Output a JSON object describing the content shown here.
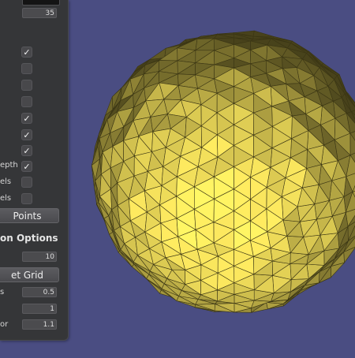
{
  "panel": {
    "number_top": "35",
    "checkboxes": [
      {
        "checked": true
      },
      {
        "checked": false
      },
      {
        "checked": false
      },
      {
        "checked": false
      },
      {
        "checked": true
      },
      {
        "checked": true
      },
      {
        "checked": true
      },
      {
        "checked": true,
        "label": "epth"
      },
      {
        "checked": false,
        "label": "els"
      },
      {
        "checked": false,
        "label": "els"
      }
    ],
    "points_button": "Points",
    "section_title": "on Options",
    "section_value": "10",
    "grid_button": "et Grid",
    "params": [
      {
        "label": "s",
        "value": "0.5"
      },
      {
        "label": "",
        "value": "1"
      },
      {
        "label": "or",
        "value": "1.1"
      }
    ],
    "check_glyph": "✓"
  },
  "viewport": {
    "background": "#4a4d82",
    "mesh_base_color": "#f0dd5a",
    "mesh_edge_color": "#3b3614"
  }
}
